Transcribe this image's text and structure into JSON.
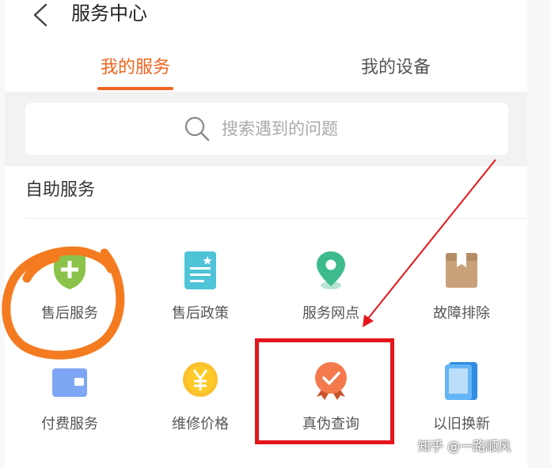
{
  "header": {
    "back_icon": "chevron-left-icon",
    "title": "服务中心"
  },
  "tabs": [
    {
      "label": "我的服务",
      "active": true
    },
    {
      "label": "我的设备",
      "active": false
    }
  ],
  "search": {
    "icon": "search-icon",
    "placeholder": "搜索遇到的问题"
  },
  "section": {
    "title": "自助服务"
  },
  "services": [
    {
      "label": "售后服务",
      "icon": "shield-plus-icon"
    },
    {
      "label": "售后政策",
      "icon": "document-star-icon"
    },
    {
      "label": "服务网点",
      "icon": "location-pin-icon"
    },
    {
      "label": "故障排除",
      "icon": "box-icon"
    },
    {
      "label": "付费服务",
      "icon": "wallet-icon"
    },
    {
      "label": "维修价格",
      "icon": "yen-coin-icon"
    },
    {
      "label": "真伪查询",
      "icon": "certified-badge-icon"
    },
    {
      "label": "以旧换新",
      "icon": "tablet-icon"
    }
  ],
  "colors": {
    "accent": "#f0641e",
    "annotation_red": "#e4161b",
    "annotation_orange": "#f47b20"
  },
  "watermark": "知乎 @一路顺风"
}
